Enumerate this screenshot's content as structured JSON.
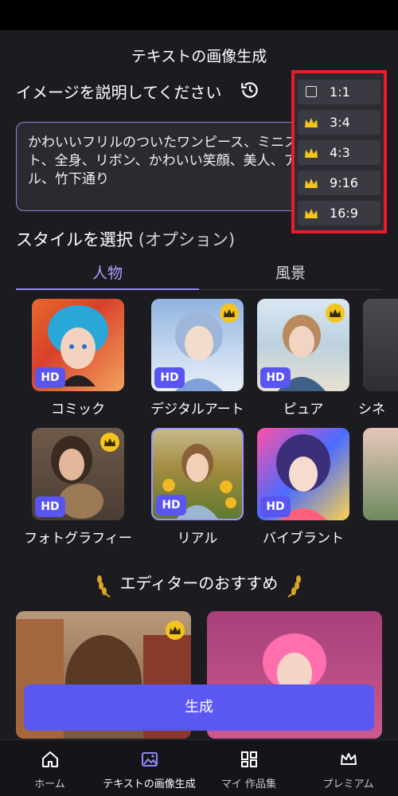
{
  "header": {
    "title": "テキストの画像生成"
  },
  "prompt": {
    "label": "イメージを説明してください",
    "text": "かわいいフリルのついたワンピース、ミニスカート、全身、リボン、かわいい笑顔、美人、アイドル、竹下通り"
  },
  "style": {
    "label": "スタイルを選択",
    "optional": "(オプション)",
    "tabs": [
      {
        "label": "人物"
      },
      {
        "label": "風景"
      }
    ],
    "items": [
      {
        "label": "コミック",
        "hd": "HD",
        "premium": false
      },
      {
        "label": "デジタルアート",
        "hd": "HD",
        "premium": true
      },
      {
        "label": "ピュア",
        "hd": "HD",
        "premium": true
      },
      {
        "label": "シネ"
      },
      {
        "label": "フォトグラフィー",
        "hd": "HD",
        "premium": true
      },
      {
        "label": "リアル",
        "hd": "HD",
        "premium": false
      },
      {
        "label": "バイブラント",
        "hd": "HD",
        "premium": false
      }
    ]
  },
  "recommend": {
    "title": "エディターのおすすめ"
  },
  "generate_button": {
    "label": "生成"
  },
  "nav": [
    {
      "label": "ホーム",
      "icon": "home-icon"
    },
    {
      "label": "テキストの画像生成",
      "icon": "image-icon"
    },
    {
      "label": "マイ 作品集",
      "icon": "grid-icon"
    },
    {
      "label": "プレミアム",
      "icon": "crown-icon"
    }
  ],
  "aspect_ratios": [
    {
      "label": "1:1",
      "premium": false
    },
    {
      "label": "3:4",
      "premium": true
    },
    {
      "label": "4:3",
      "premium": true
    },
    {
      "label": "9:16",
      "premium": true
    },
    {
      "label": "16:9",
      "premium": true
    }
  ],
  "colors": {
    "accent": "#5b57f1",
    "highlight_border": "#ea1b2a",
    "crown": "#f4c51f"
  }
}
